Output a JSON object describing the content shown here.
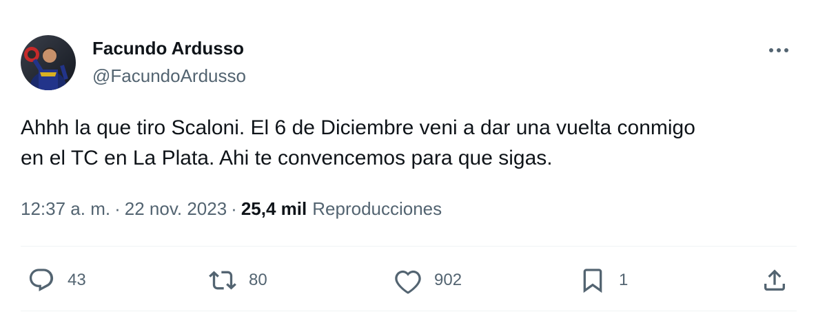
{
  "author": {
    "display_name": "Facundo Ardusso",
    "handle": "@FacundoArdusso"
  },
  "tweet": {
    "text_lines": [
      "Ahhh la que tiro Scaloni. El 6 de Diciembre veni a dar una vuelta conmigo",
      "en el TC en La Plata. Ahi te convencemos para que sigas."
    ],
    "time": "12:37 a. m.",
    "separator": "·",
    "date": "22 nov. 2023",
    "views_count": "25,4 mil",
    "views_label": "Reproducciones"
  },
  "actions": {
    "reply": {
      "icon": "reply-icon",
      "count": "43"
    },
    "retweet": {
      "icon": "retweet-icon",
      "count": "80"
    },
    "like": {
      "icon": "heart-icon",
      "count": "902"
    },
    "bookmark": {
      "icon": "bookmark-icon",
      "count": "1"
    },
    "share": {
      "icon": "share-icon"
    }
  },
  "more_icon": "more-dots-icon",
  "colors": {
    "text": "#0f1419",
    "secondary": "#536471",
    "divider": "#eff3f4"
  }
}
